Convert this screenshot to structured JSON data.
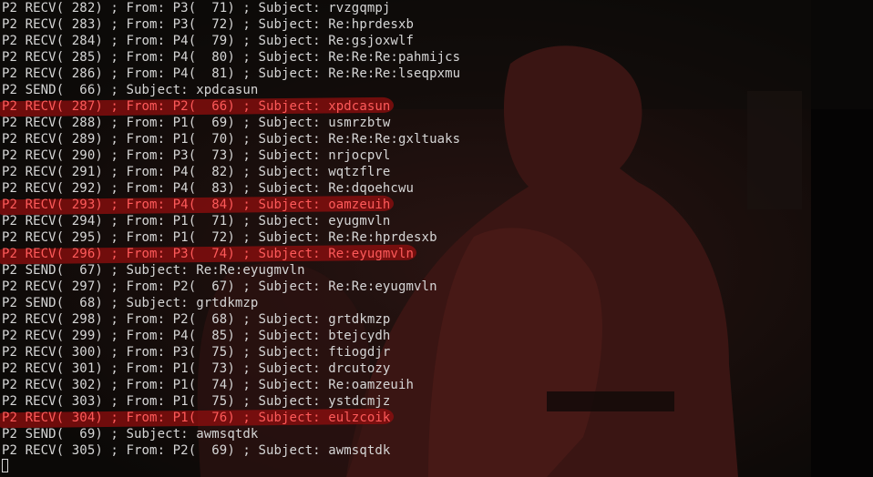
{
  "terminal": {
    "lines": [
      {
        "text": "P2 RECV( 282) ; From: P3(  71) ; Subject: rvzgqmpj",
        "highlight": false
      },
      {
        "text": "P2 RECV( 283) ; From: P3(  72) ; Subject: Re:hprdesxb",
        "highlight": false
      },
      {
        "text": "P2 RECV( 284) ; From: P4(  79) ; Subject: Re:gsjoxwlf",
        "highlight": false
      },
      {
        "text": "P2 RECV( 285) ; From: P4(  80) ; Subject: Re:Re:Re:pahmijcs",
        "highlight": false
      },
      {
        "text": "P2 RECV( 286) ; From: P4(  81) ; Subject: Re:Re:Re:lseqpxmu",
        "highlight": false
      },
      {
        "text": "P2 SEND(  66) ; Subject: xpdcasun",
        "highlight": false
      },
      {
        "text": "P2 RECV( 287) ; From: P2(  66) ; Subject: xpdcasun",
        "highlight": true
      },
      {
        "text": "P2 RECV( 288) ; From: P1(  69) ; Subject: usmrzbtw",
        "highlight": false
      },
      {
        "text": "P2 RECV( 289) ; From: P1(  70) ; Subject: Re:Re:Re:gxltuaks",
        "highlight": false
      },
      {
        "text": "P2 RECV( 290) ; From: P3(  73) ; Subject: nrjocpvl",
        "highlight": false
      },
      {
        "text": "P2 RECV( 291) ; From: P4(  82) ; Subject: wqtzflre",
        "highlight": false
      },
      {
        "text": "P2 RECV( 292) ; From: P4(  83) ; Subject: Re:dqoehcwu",
        "highlight": false
      },
      {
        "text": "P2 RECV( 293) ; From: P4(  84) ; Subject: oamzeuih",
        "highlight": true
      },
      {
        "text": "P2 RECV( 294) ; From: P1(  71) ; Subject: eyugmvln",
        "highlight": false
      },
      {
        "text": "P2 RECV( 295) ; From: P1(  72) ; Subject: Re:Re:hprdesxb",
        "highlight": false
      },
      {
        "text": "P2 RECV( 296) ; From: P3(  74) ; Subject: Re:eyugmvln",
        "highlight": true
      },
      {
        "text": "P2 SEND(  67) ; Subject: Re:Re:eyugmvln",
        "highlight": false
      },
      {
        "text": "P2 RECV( 297) ; From: P2(  67) ; Subject: Re:Re:eyugmvln",
        "highlight": false
      },
      {
        "text": "P2 SEND(  68) ; Subject: grtdkmzp",
        "highlight": false
      },
      {
        "text": "P2 RECV( 298) ; From: P2(  68) ; Subject: grtdkmzp",
        "highlight": false
      },
      {
        "text": "P2 RECV( 299) ; From: P4(  85) ; Subject: btejcydh",
        "highlight": false
      },
      {
        "text": "P2 RECV( 300) ; From: P3(  75) ; Subject: ftiogdjr",
        "highlight": false
      },
      {
        "text": "P2 RECV( 301) ; From: P1(  73) ; Subject: drcutozy",
        "highlight": false
      },
      {
        "text": "P2 RECV( 302) ; From: P1(  74) ; Subject: Re:oamzeuih",
        "highlight": false
      },
      {
        "text": "P2 RECV( 303) ; From: P1(  75) ; Subject: ystdcmjz",
        "highlight": false
      },
      {
        "text": "P2 RECV( 304) ; From: P1(  76) ; Subject: eulzcoik",
        "highlight": true
      },
      {
        "text": "P2 SEND(  69) ; Subject: awmsqtdk",
        "highlight": false
      },
      {
        "text": "P2 RECV( 305) ; From: P2(  69) ; Subject: awmsqtdk",
        "highlight": false
      }
    ]
  },
  "colors": {
    "text": "#d6d6d6",
    "highlight_text": "#ff5a5a",
    "highlight_stroke": "#960e0e",
    "background": "#0a0907"
  }
}
